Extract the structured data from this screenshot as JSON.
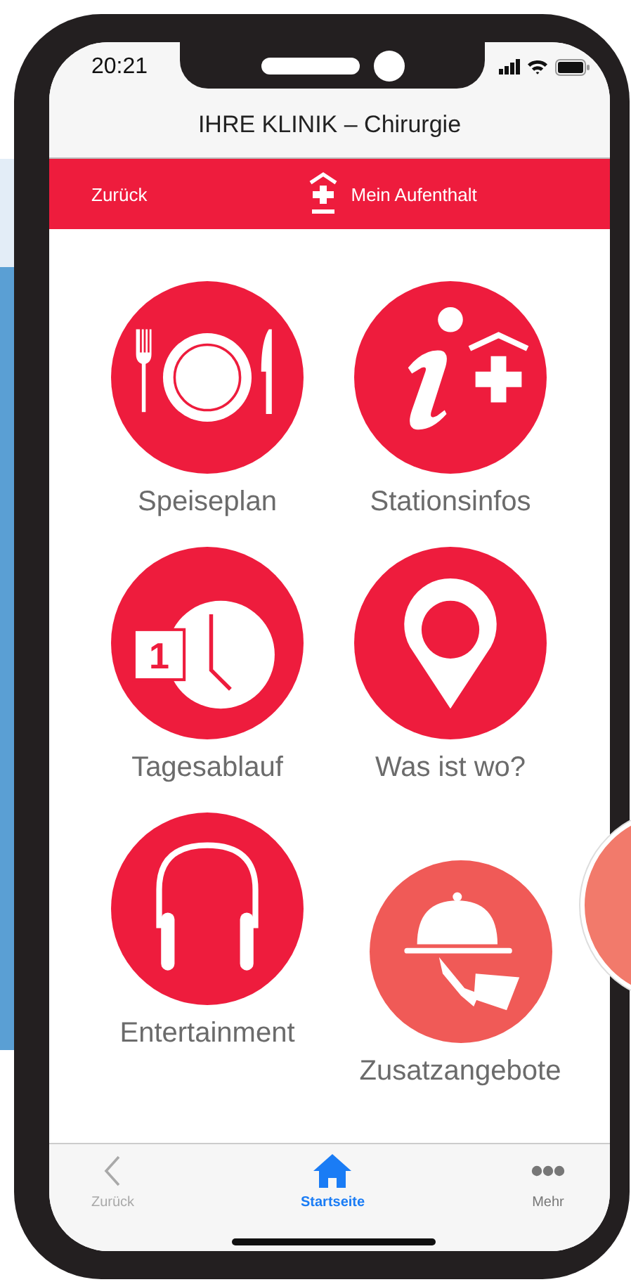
{
  "status_bar": {
    "time": "20:21"
  },
  "nav_bar": {
    "title": "IHRE KLINIK – Chirurgie"
  },
  "sub_bar": {
    "back": "Zurück",
    "title": "Mein Aufenthalt"
  },
  "tiles": [
    {
      "kind": "meal",
      "label": "Speiseplan",
      "highlighted": false
    },
    {
      "kind": "info",
      "label": "Stationsinfos",
      "highlighted": false
    },
    {
      "kind": "schedule",
      "label": "Tagesablauf",
      "icon_text": "1",
      "highlighted": false
    },
    {
      "kind": "location",
      "label": "Was ist wo?",
      "highlighted": false
    },
    {
      "kind": "music",
      "label": "Entertainment",
      "highlighted": false
    },
    {
      "kind": "service",
      "label": "Zusatzangebote",
      "highlighted": true
    }
  ],
  "tab_bar": [
    {
      "kind": "back",
      "label": "Zurück",
      "selected": false,
      "disabled": true
    },
    {
      "kind": "home",
      "label": "Startseite",
      "selected": true,
      "disabled": false
    },
    {
      "kind": "more",
      "label": "Mehr",
      "selected": false,
      "disabled": false
    }
  ]
}
